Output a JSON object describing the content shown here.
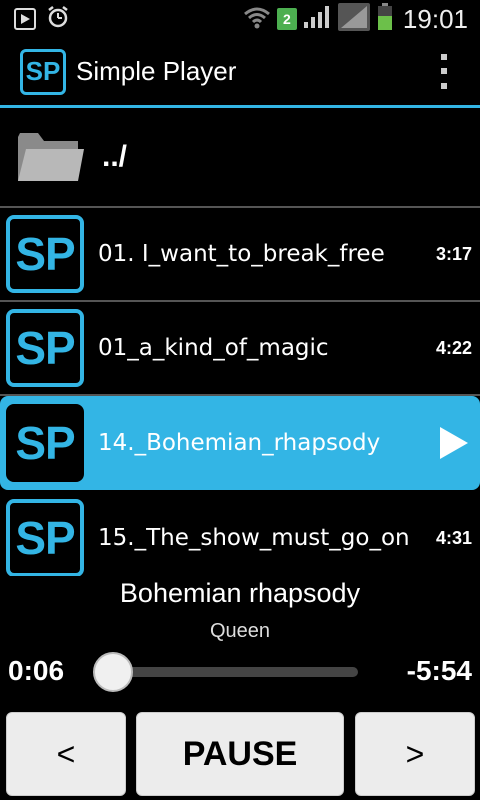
{
  "status_bar": {
    "icons": [
      "play-notification-icon",
      "alarm-icon",
      "wifi-icon",
      "signal-icon",
      "battery-icon"
    ],
    "badge": "2",
    "time": "19:01"
  },
  "action_bar": {
    "logo_text": "SP",
    "title": "Simple Player",
    "accent_color": "#33b5e5"
  },
  "list": {
    "parent_folder": "../",
    "tracks": [
      {
        "icon": "SP",
        "title": "01. I_want_to_break_free",
        "duration": "3:17",
        "selected": false
      },
      {
        "icon": "SP",
        "title": "01_a_kind_of_magic",
        "duration": "4:22",
        "selected": false
      },
      {
        "icon": "SP",
        "title": "14._Bohemian_rhapsody",
        "duration": "",
        "selected": true
      },
      {
        "icon": "SP",
        "title": "15._The_show_must_go_on",
        "duration": "4:31",
        "selected": false
      }
    ]
  },
  "now_playing": {
    "title": "Bohemian rhapsody",
    "artist": "Queen",
    "elapsed": "0:06",
    "remaining": "-5:54",
    "progress": 0.02
  },
  "controls": {
    "prev_label": "<",
    "pause_label": "PAUSE",
    "next_label": ">"
  }
}
